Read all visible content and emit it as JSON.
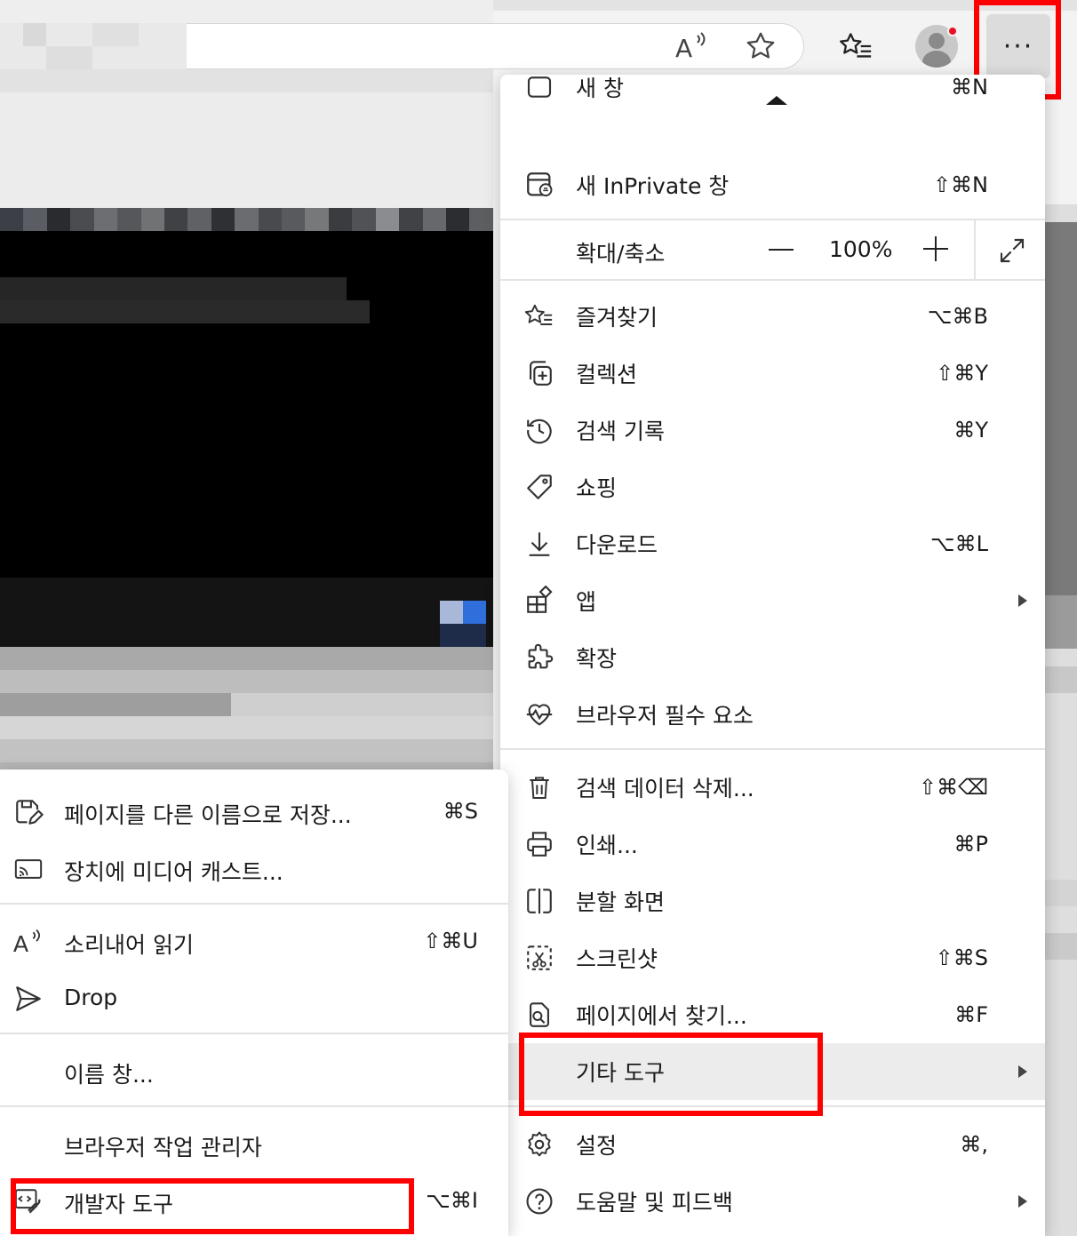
{
  "toolbar": {
    "more_button": "···",
    "read_aloud_icon": "read-aloud-icon",
    "favorite_icon": "star-icon",
    "favorites_icon": "favorites-list-icon",
    "profile_icon": "avatar-icon",
    "notification_color": "#e81123"
  },
  "menu": {
    "new_window": {
      "label": "새 창",
      "shortcut": "⌘N"
    },
    "inprivate": {
      "label": "새 InPrivate 창",
      "shortcut": "⇧⌘N"
    },
    "zoom": {
      "label": "확대/축소",
      "value": "100%"
    },
    "items": [
      {
        "id": "favorites",
        "label": "즐겨찾기",
        "shortcut": "⌥⌘B"
      },
      {
        "id": "collections",
        "label": "컬렉션",
        "shortcut": "⇧⌘Y"
      },
      {
        "id": "history",
        "label": "검색 기록",
        "shortcut": "⌘Y"
      },
      {
        "id": "shopping",
        "label": "쇼핑",
        "shortcut": ""
      },
      {
        "id": "downloads",
        "label": "다운로드",
        "shortcut": "⌥⌘L"
      },
      {
        "id": "apps",
        "label": "앱",
        "shortcut": ""
      },
      {
        "id": "extensions",
        "label": "확장",
        "shortcut": ""
      },
      {
        "id": "essentials",
        "label": "브라우저 필수 요소",
        "shortcut": ""
      },
      {
        "id": "clear-data",
        "label": "검색 데이터 삭제...",
        "shortcut": "⇧⌘⌫"
      },
      {
        "id": "print",
        "label": "인쇄...",
        "shortcut": "⌘P"
      },
      {
        "id": "split-screen",
        "label": "분할 화면",
        "shortcut": ""
      },
      {
        "id": "screenshot",
        "label": "스크린샷",
        "shortcut": "⇧⌘S"
      },
      {
        "id": "find",
        "label": "페이지에서 찾기...",
        "shortcut": "⌘F"
      },
      {
        "id": "more-tools",
        "label": "기타 도구",
        "shortcut": ""
      },
      {
        "id": "settings",
        "label": "설정",
        "shortcut": "⌘,"
      },
      {
        "id": "help",
        "label": "도움말 및 피드백",
        "shortcut": ""
      }
    ]
  },
  "submenu": {
    "items": [
      {
        "id": "save-as",
        "label": "페이지를 다른 이름으로 저장...",
        "shortcut": "⌘S"
      },
      {
        "id": "cast",
        "label": "장치에 미디어 캐스트...",
        "shortcut": ""
      },
      {
        "id": "read-aloud",
        "label": "소리내어 읽기",
        "shortcut": "⇧⌘U"
      },
      {
        "id": "drop",
        "label": "Drop",
        "shortcut": ""
      },
      {
        "id": "name-window",
        "label": "이름 창...",
        "shortcut": ""
      },
      {
        "id": "task-manager",
        "label": "브라우저 작업 관리자",
        "shortcut": ""
      },
      {
        "id": "devtools",
        "label": "개발자 도구",
        "shortcut": "⌥⌘I"
      }
    ]
  },
  "colors": {
    "highlight": "#ff0000",
    "menu_bg": "#ffffff",
    "hover_bg": "#ececec"
  }
}
